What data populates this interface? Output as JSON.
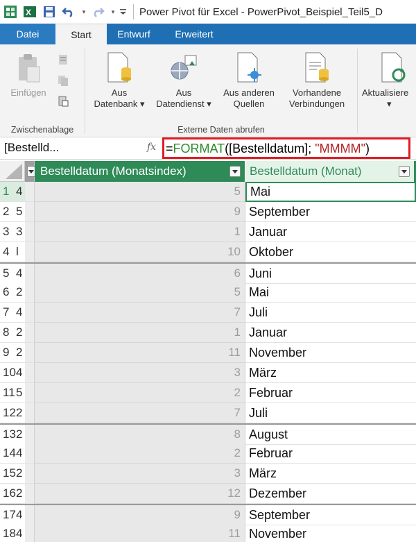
{
  "window": {
    "title": "Power Pivot für Excel - PowerPivot_Beispiel_Teil5_D"
  },
  "tabs": [
    {
      "label": "Datei"
    },
    {
      "label": "Start"
    },
    {
      "label": "Entwurf"
    },
    {
      "label": "Erweitert"
    }
  ],
  "ribbon": {
    "clipboard": {
      "paste_label": "Einfügen",
      "group_label": "Zwischenablage"
    },
    "external": {
      "group_label": "Externe Daten abrufen",
      "btn_db_line1": "Aus",
      "btn_db_line2": "Datenbank",
      "btn_ds_line1": "Aus",
      "btn_ds_line2": "Datendienst",
      "btn_other_line1": "Aus anderen",
      "btn_other_line2": "Quellen",
      "btn_existing_line1": "Vorhandene",
      "btn_existing_line2": "Verbindungen"
    },
    "refresh": {
      "label": "Aktualisiere"
    }
  },
  "formula_bar": {
    "name_box": "[Bestelld...",
    "fx": "fx",
    "f_eq": "=",
    "f_fn": "FORMAT",
    "f_mid": "([Bestelldatum]; ",
    "f_str": "\"MMMM\"",
    "f_end": ")"
  },
  "grid": {
    "col1_header": "Bestelldatum (Monatsindex)",
    "col2_header": "Bestelldatum (Monat)",
    "rows": [
      {
        "num": "1",
        "cut": "4",
        "index": "5",
        "month": "Mai"
      },
      {
        "num": "2",
        "cut": "5",
        "index": "9",
        "month": "September"
      },
      {
        "num": "3",
        "cut": "3",
        "index": "1",
        "month": "Januar"
      },
      {
        "num": "4",
        "cut": "l",
        "index": "10",
        "month": "Oktober"
      },
      {
        "num": "5",
        "cut": "4",
        "index": "6",
        "month": "Juni"
      },
      {
        "num": "6",
        "cut": "2",
        "index": "5",
        "month": "Mai"
      },
      {
        "num": "7",
        "cut": "4",
        "index": "7",
        "month": "Juli"
      },
      {
        "num": "8",
        "cut": "2",
        "index": "1",
        "month": "Januar"
      },
      {
        "num": "9",
        "cut": "2",
        "index": "11",
        "month": "November"
      },
      {
        "num": "10",
        "cut": "4",
        "index": "3",
        "month": "März"
      },
      {
        "num": "11",
        "cut": "5",
        "index": "2",
        "month": "Februar"
      },
      {
        "num": "12",
        "cut": "2",
        "index": "7",
        "month": "Juli"
      },
      {
        "num": "13",
        "cut": "2",
        "index": "8",
        "month": "August"
      },
      {
        "num": "14",
        "cut": "4",
        "index": "2",
        "month": "Februar"
      },
      {
        "num": "15",
        "cut": "2",
        "index": "3",
        "month": "März"
      },
      {
        "num": "16",
        "cut": "2",
        "index": "12",
        "month": "Dezember"
      },
      {
        "num": "17",
        "cut": "4",
        "index": "9",
        "month": "September"
      },
      {
        "num": "18",
        "cut": "4",
        "index": "11",
        "month": "November"
      }
    ]
  },
  "colors": {
    "tab_blue": "#1f6fb4",
    "column_green": "#2e8b57",
    "highlight_red": "#e31b23",
    "formula_function": "#2e8b2e",
    "formula_string": "#b22222"
  }
}
